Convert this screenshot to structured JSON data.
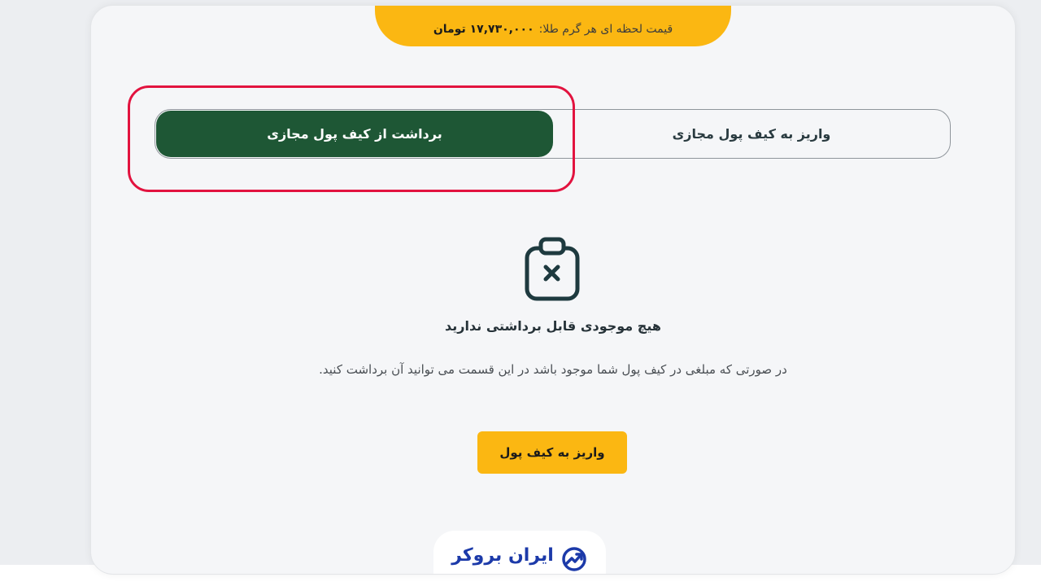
{
  "price_banner": {
    "label": "قیمت لحظه ای هر گرم طلا:",
    "value": "۱۷,۷۳۰,۰۰۰ تومان"
  },
  "tabs": [
    {
      "label": "برداشت از کیف پول مجازی",
      "active": true
    },
    {
      "label": "واریز به کیف پول مجازی",
      "active": false
    }
  ],
  "empty_state": {
    "icon": "clipboard-x-icon",
    "title": "هیچ موجودی قابل برداشتی ندارید",
    "description": "در صورتی که مبلغی در کیف پول شما موجود باشد در این قسمت می توانید آن برداشت کنید."
  },
  "deposit_button": {
    "label": "واریز به کیف پول"
  },
  "brand": {
    "name": "ایران بروکر",
    "icon": "chart-trend-icon"
  },
  "colors": {
    "accent_yellow": "#fbb712",
    "active_green": "#1e5735",
    "highlight_red": "#e2133f",
    "brand_blue": "#1c3aa9"
  }
}
